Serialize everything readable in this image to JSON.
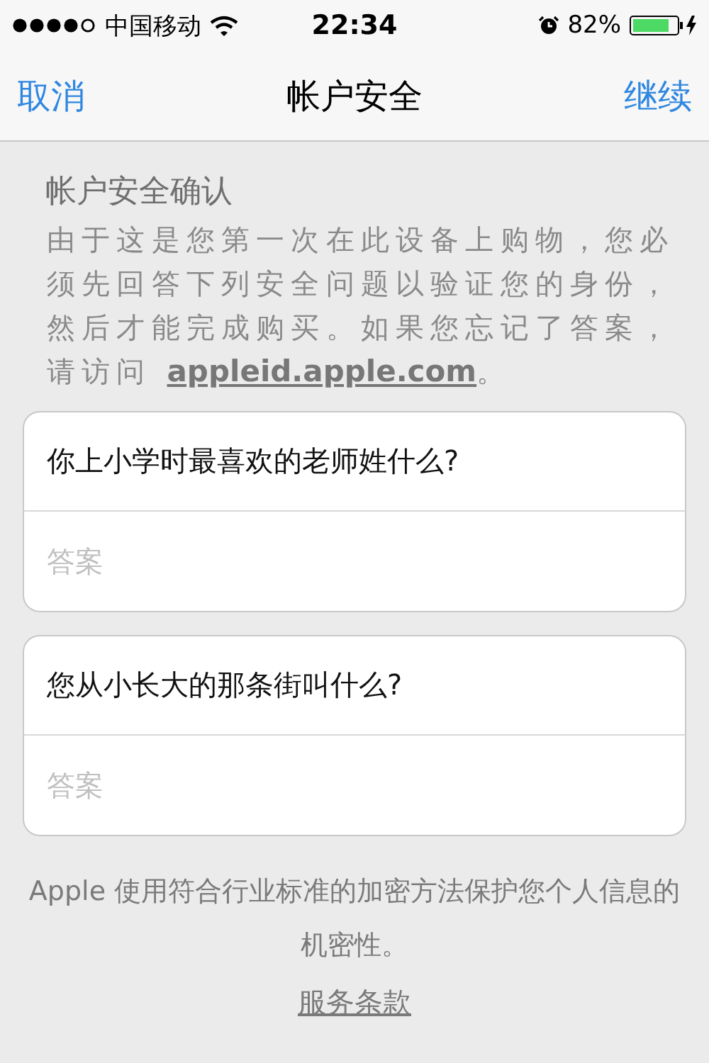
{
  "status_bar": {
    "carrier": "中国移动",
    "time": "22:34",
    "battery": "82%"
  },
  "nav_bar": {
    "left": "取消",
    "title": "帐户安全",
    "right": "继续"
  },
  "intro": {
    "heading": "帐户安全确认",
    "text": "由于这是您第一次在此设备上购物，您必须先回答下列安全问题以验证您的身份，然后才能完成购买。如果您忘记了答案，请访问 ",
    "link": "appleid.apple.com",
    "text_end": "。"
  },
  "questions": [
    {
      "question": "你上小学时最喜欢的老师姓什么?",
      "placeholder": "答案"
    },
    {
      "question": "您从小长大的那条街叫什么?",
      "placeholder": "答案"
    }
  ],
  "footer": {
    "note": "Apple 使用符合行业标准的加密方法保护您个人信息的机密性。",
    "link": "服务条款"
  }
}
